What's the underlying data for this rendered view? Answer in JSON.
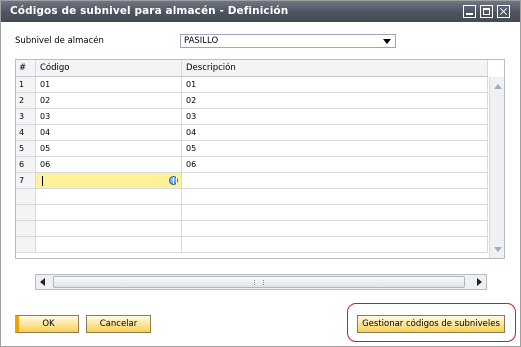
{
  "window": {
    "title": "Códigos de subnivel para almacén - Definición"
  },
  "form": {
    "subnivel_label": "Subnivel de almacén",
    "subnivel_value": "PASILLO"
  },
  "table": {
    "headers": [
      "#",
      "Código",
      "Descripción"
    ],
    "rows": [
      {
        "num": "1",
        "codigo": "01",
        "descripcion": "01"
      },
      {
        "num": "2",
        "codigo": "02",
        "descripcion": "02"
      },
      {
        "num": "3",
        "codigo": "03",
        "descripcion": "03"
      },
      {
        "num": "4",
        "codigo": "04",
        "descripcion": "04"
      },
      {
        "num": "5",
        "codigo": "05",
        "descripcion": "05"
      },
      {
        "num": "6",
        "codigo": "06",
        "descripcion": "06"
      },
      {
        "num": "7",
        "codigo": "",
        "descripcion": ""
      }
    ]
  },
  "buttons": {
    "ok": "OK",
    "cancel": "Cancelar",
    "manage": "Gestionar códigos de subniveles"
  },
  "colors": {
    "active_cell": "#fff09a",
    "highlight_outline": "#d21b1b",
    "titlebar": "#4d5360"
  }
}
